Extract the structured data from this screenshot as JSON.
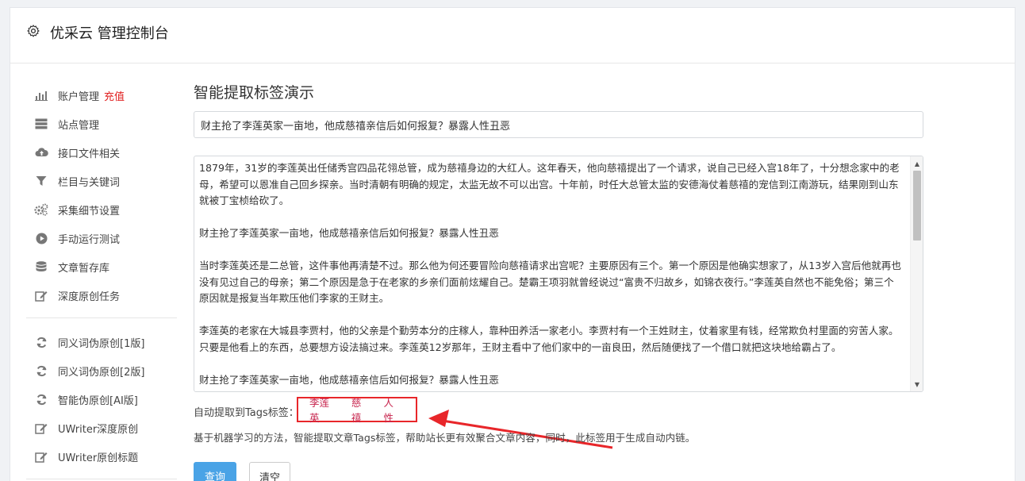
{
  "header": {
    "title": "优采云 管理控制台",
    "icon": "gear-icon"
  },
  "sidebar": {
    "group1": [
      {
        "label": "账户管理",
        "badge": "充值",
        "icon": "bar-chart-icon"
      },
      {
        "label": "站点管理",
        "icon": "server-icon"
      },
      {
        "label": "接口文件相关",
        "icon": "cloud-upload-icon"
      },
      {
        "label": "栏目与关键词",
        "icon": "filter-icon"
      },
      {
        "label": "采集细节设置",
        "icon": "gears-icon"
      },
      {
        "label": "手动运行测试",
        "icon": "play-circle-icon"
      },
      {
        "label": "文章暂存库",
        "icon": "database-icon"
      },
      {
        "label": "深度原创任务",
        "icon": "edit-icon"
      }
    ],
    "group2": [
      {
        "label": "同义词伪原创[1版]",
        "icon": "refresh-icon"
      },
      {
        "label": "同义词伪原创[2版]",
        "icon": "refresh-icon"
      },
      {
        "label": "智能伪原创[AI版]",
        "icon": "refresh-icon"
      },
      {
        "label": "UWriter深度原创",
        "icon": "edit-icon"
      },
      {
        "label": "UWriter原创标题",
        "icon": "edit-icon"
      }
    ]
  },
  "main": {
    "title": "智能提取标签演示",
    "title_input_value": "财主抢了李莲英家一亩地，他成慈禧亲信后如何报复？暴露人性丑恶",
    "content_text": "1879年，31岁的李莲英出任储秀宫四品花翎总管，成为慈禧身边的大红人。这年春天，他向慈禧提出了一个请求，说自己已经入宫18年了，十分想念家中的老母，希望可以恩准自己回乡探亲。当时清朝有明确的规定，太监无故不可以出宫。十年前，时任大总管太监的安德海仗着慈禧的宠信到江南游玩，结果刚到山东就被丁宝桢给砍了。\n\n财主抢了李莲英家一亩地，他成慈禧亲信后如何报复？暴露人性丑恶\n\n当时李莲英还是二总管，这件事他再清楚不过。那么他为何还要冒险向慈禧请求出宫呢？主要原因有三个。第一个原因是他确实想家了，从13岁入宫后他就再也没有见过自己的母亲；第二个原因是急于在老家的乡亲们面前炫耀自己。楚霸王项羽就曾经说过“富贵不归故乡，如锦衣夜行。”李莲英自然也不能免俗；第三个原因就是报复当年欺压他们李家的王财主。\n\n李莲英的老家在大城县李贾村，他的父亲是个勤劳本分的庄稼人，靠种田养活一家老小。李贾村有一个王姓财主，仗着家里有钱，经常欺负村里面的穷苦人家。只要是他看上的东西，总要想方设法搞过来。李莲英12岁那年，王财主看中了他们家中的一亩良田，然后随便找了一个借口就把这块地给霸占了。\n\n财主抢了李莲英家一亩地，他成慈禧亲信后如何报复？暴露人性丑恶",
    "tags_label": "自动提取到Tags标签：",
    "tags": [
      "李莲英",
      "慈禧",
      "人性"
    ],
    "description": "基于机器学习的方法，智能提取文章Tags标签，帮助站长更有效聚合文章内容，同时，此标签用于生成自动内链。",
    "submit_label": "查询",
    "clear_label": "清空"
  },
  "colors": {
    "accent": "#4aa3e6",
    "highlight": "#e8262a",
    "tag": "#c7254e",
    "badge": "#e02020"
  }
}
